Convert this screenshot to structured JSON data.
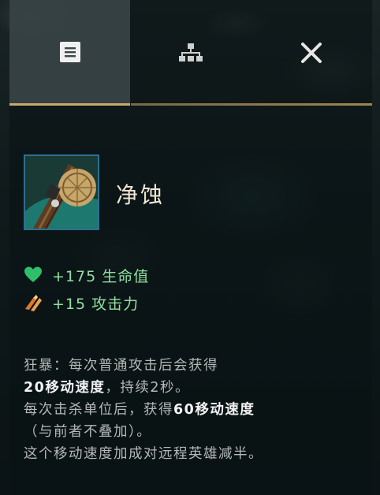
{
  "tabs": [
    {
      "name": "details",
      "icon": "list-icon",
      "active": true
    },
    {
      "name": "recipe",
      "icon": "hierarchy-icon",
      "active": false
    },
    {
      "name": "close",
      "icon": "close-icon",
      "active": false
    }
  ],
  "item": {
    "name": "净蚀",
    "icon": "item-portrait"
  },
  "stats": [
    {
      "icon": "heart-icon",
      "text": "+175 生命值",
      "color": "#8fe0a0"
    },
    {
      "icon": "attack-damage-icon",
      "text": "+15 攻击力",
      "color": "#8fe0a0"
    }
  ],
  "description": {
    "line1": "狂暴：每次普通攻击后会获得",
    "line2_bold": "20移动速度",
    "line2_rest": "，持续2秒。",
    "line3_pre": "每次击杀单位后，获得",
    "line3_bold": "60移动速度",
    "line4": "（与前者不叠加）。",
    "line5": "这个移动速度加成对远程英雄减半。"
  },
  "colors": {
    "accent_gold": "#c8aa6e",
    "stat_green": "#8fe0a0",
    "heart_green": "#2fbf6a",
    "attack_orange": "#e0782a"
  }
}
